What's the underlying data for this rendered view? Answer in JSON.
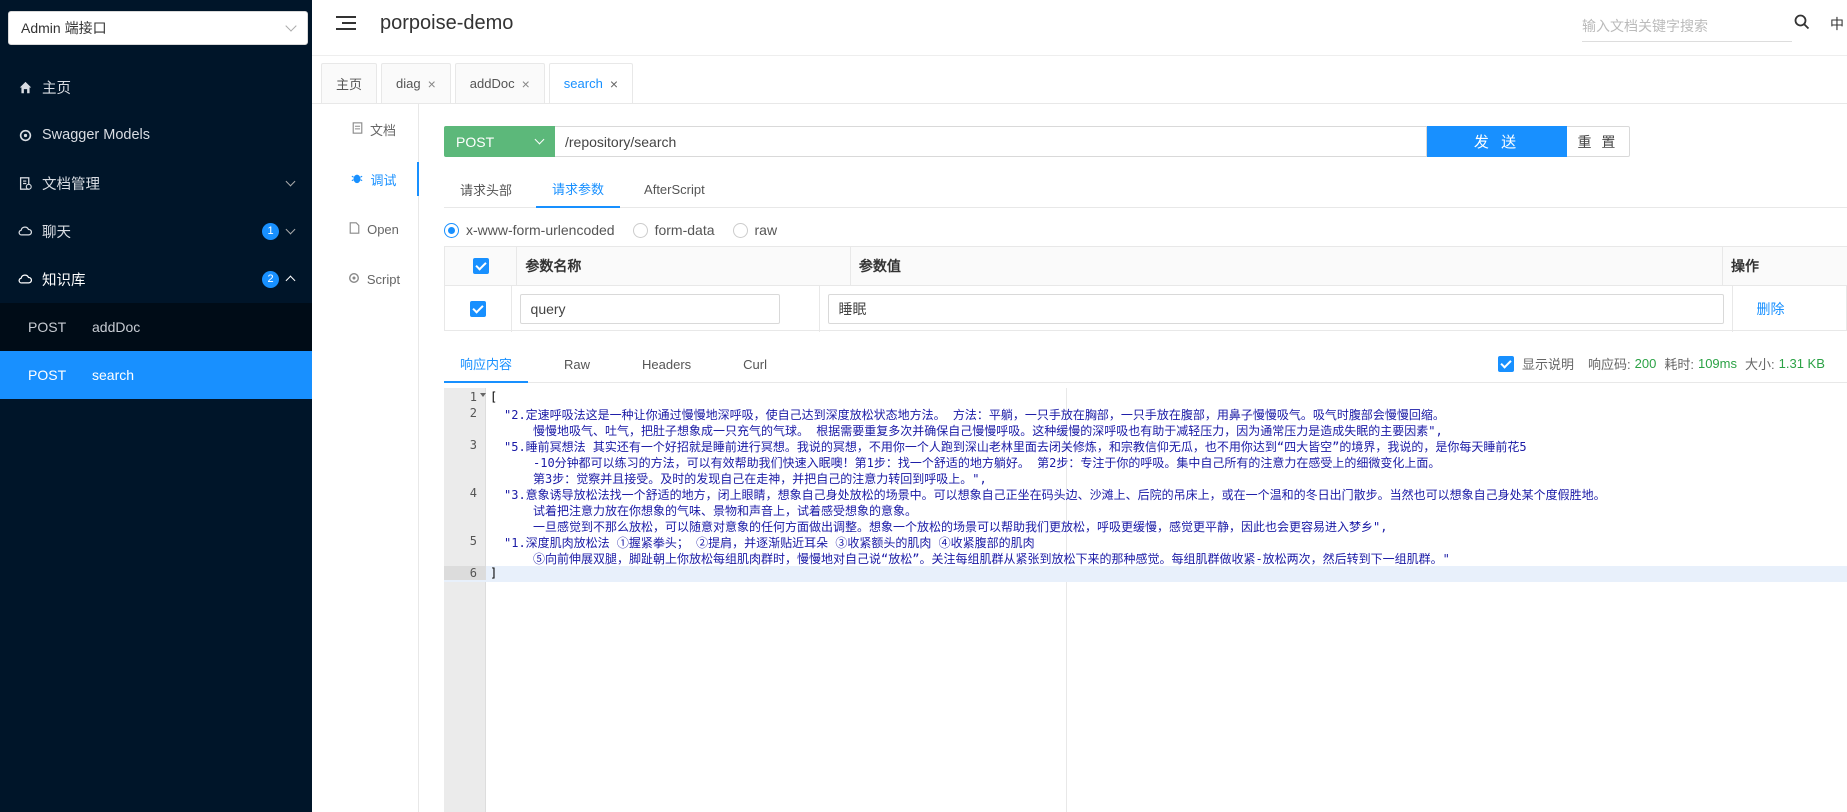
{
  "sidebar": {
    "api_select": "Admin 端接口",
    "items": [
      {
        "label": "主页",
        "icon": "home-icon"
      },
      {
        "label": "Swagger Models",
        "icon": "settings-icon"
      },
      {
        "label": "文档管理",
        "icon": "doc-icon"
      },
      {
        "label": "聊天",
        "icon": "cloud-icon",
        "badge": "1"
      },
      {
        "label": "知识库",
        "icon": "cloud-icon",
        "badge": "2"
      }
    ],
    "sub_items": [
      {
        "method": "POST",
        "name": "addDoc"
      },
      {
        "method": "POST",
        "name": "search"
      }
    ]
  },
  "header": {
    "title": "porpoise-demo",
    "search_placeholder": "输入文档关键字搜索",
    "lang": "中"
  },
  "tabs": [
    {
      "label": "主页"
    },
    {
      "label": "diag"
    },
    {
      "label": "addDoc"
    },
    {
      "label": "search"
    }
  ],
  "side_tabs": [
    "文档",
    "调试",
    "Open",
    "Script"
  ],
  "request": {
    "method": "POST",
    "url": "/repository/search",
    "send_label": "发 送",
    "reset_label": "重 置",
    "tabs": [
      "请求头部",
      "请求参数",
      "AfterScript"
    ],
    "content_types": [
      "x-www-form-urlencoded",
      "form-data",
      "raw"
    ],
    "table": {
      "headers": [
        "参数名称",
        "参数值",
        "操作"
      ],
      "rows": [
        {
          "name": "query",
          "value": "睡眠",
          "action": "删除"
        }
      ]
    }
  },
  "response": {
    "tabs": [
      "响应内容",
      "Raw",
      "Headers",
      "Curl"
    ],
    "show_desc_label": "显示说明",
    "code_label": "响应码:",
    "code": "200",
    "time_label": "耗时:",
    "time": "109ms",
    "size_label": "大小:",
    "size": "1.31 KB",
    "lines": [
      {
        "n": "1",
        "segments": [
          "["
        ]
      },
      {
        "n": "2",
        "segments": [
          "\"2.定速呼吸法这是一种让你通过慢慢地深呼吸，使自己达到深度放松状态地方法。 方法：平躺，一只手放在胸部，一只手放在腹部，用鼻子慢慢吸气。吸气时腹部会慢慢回缩。",
          "慢慢地吸气、吐气，把肚子想象成一只充气的气球。 根据需要重复多次并确保自己慢慢呼吸。这种缓慢的深呼吸也有助于减轻压力，因为通常压力是造成失眠的主要因素\","
        ]
      },
      {
        "n": "3",
        "segments": [
          "\"5.睡前冥想法 其实还有一个好招就是睡前进行冥想。我说的冥想，不用你一个人跑到深山老林里面去闭关修炼，和宗教信仰无瓜，也不用你达到“四大皆空”的境界，我说的，是你每天睡前花5",
          "-10分钟都可以练习的方法，可以有效帮助我们快速入眠噢！第1步：找一个舒适的地方躺好。 第2步：专注于你的呼吸。集中自己所有的注意力在感受上的细微变化上面。",
          "第3步：觉察并且接受。及时的发现自己在走神，并把自己的注意力转回到呼吸上。\","
        ]
      },
      {
        "n": "4",
        "segments": [
          "\"3.意象诱导放松法找一个舒适的地方，闭上眼睛，想象自己身处放松的场景中。可以想象自己正坐在码头边、沙滩上、后院的吊床上，或在一个温和的冬日出门散步。当然也可以想象自己身处某个度假胜地。",
          "试着把注意力放在你想象的气味、景物和声音上，试着感受想象的意象。",
          "一旦感觉到不那么放松，可以随意对意象的任何方面做出调整。想象一个放松的场景可以帮助我们更放松，呼吸更缓慢，感觉更平静，因此也会更容易进入梦乡\","
        ]
      },
      {
        "n": "5",
        "segments": [
          "\"1.深度肌肉放松法 ①握紧拳头； ②提肩，并逐渐贴近耳朵 ③收紧额头的肌肉 ④收紧腹部的肌肉",
          "⑤向前伸展双腿，脚趾朝上你放松每组肌肉群时，慢慢地对自己说“放松”。关注每组肌群从紧张到放松下来的那种感觉。每组肌群做收紧-放松两次，然后转到下一组肌群。\""
        ]
      },
      {
        "n": "6",
        "segments": [
          "]"
        ]
      }
    ]
  },
  "colors": {
    "sidebar_bg": "#001529",
    "accent": "#1890ff",
    "method_green": "#5cb87a",
    "string_blue": "#1a1aa6",
    "success_green": "#2ba245"
  }
}
